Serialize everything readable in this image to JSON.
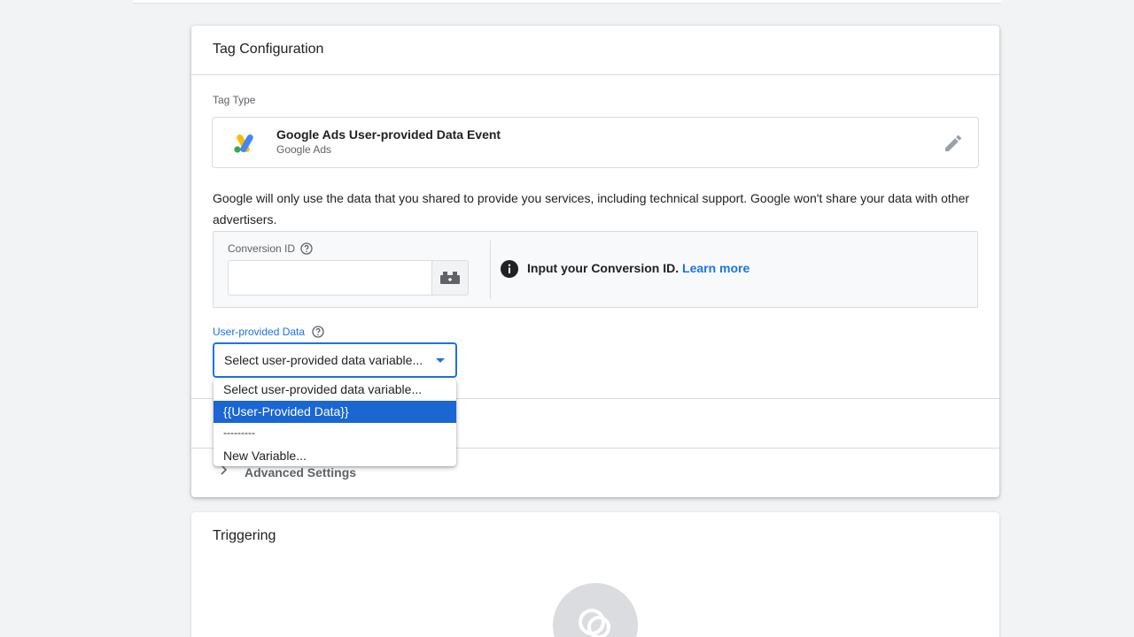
{
  "tag_config": {
    "title": "Tag Configuration",
    "tag_type_label": "Tag Type",
    "tag_type_name": "Google Ads User-provided Data Event",
    "tag_type_sub": "Google Ads",
    "notice": "Google will only use the data that you shared to provide you services, including technical support. Google won't share your data with other advertisers.",
    "conversion_id": {
      "label": "Conversion ID",
      "value": "",
      "info_text": "Input your Conversion ID.",
      "learn_more": "Learn more"
    },
    "user_provided_data": {
      "label": "User-provided Data",
      "selected": "Select user-provided data variable...",
      "options": [
        "Select user-provided data variable...",
        "{{User-Provided Data}}",
        "---------",
        "New Variable..."
      ]
    },
    "advanced_settings": "Advanced Settings"
  },
  "triggering": {
    "title": "Triggering"
  },
  "colors": {
    "accent": "#1a73e8",
    "selected_option": "#1a66d2"
  },
  "icons": [
    "google-ads-logo",
    "edit-pencil-icon",
    "help-icon",
    "variable-block-icon",
    "info-icon",
    "chevron-right-icon",
    "trigger-icon"
  ]
}
